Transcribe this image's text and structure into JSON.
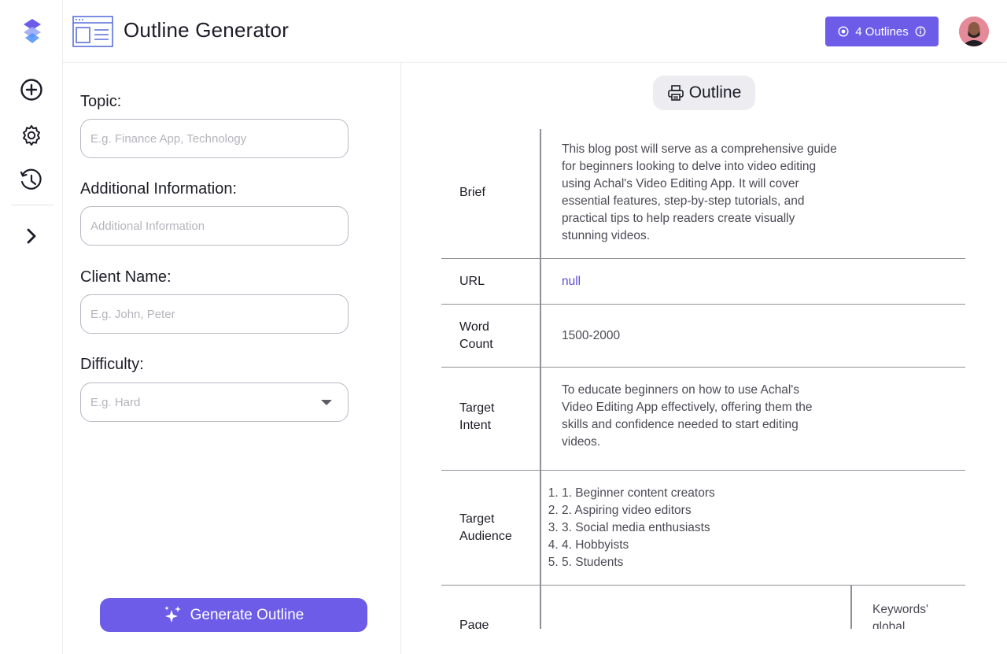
{
  "header": {
    "title": "Outline Generator",
    "badge_label": "4 Outlines"
  },
  "rail": {
    "icons": [
      "logo-icon",
      "add-icon",
      "settings-icon",
      "history-icon",
      "chevron-right-icon"
    ]
  },
  "form": {
    "topic_label": "Topic:",
    "topic_placeholder": "E.g. Finance App, Technology",
    "additional_label": "Additional Information:",
    "additional_placeholder": "Additional Information",
    "client_label": "Client Name:",
    "client_placeholder": "E.g. John, Peter",
    "difficulty_label": "Difficulty:",
    "difficulty_placeholder": "E.g. Hard",
    "generate_label": "Generate Outline"
  },
  "outline": {
    "chip_label": "Outline",
    "rows": [
      {
        "key": "Brief",
        "value": "This blog post will serve as a comprehensive guide for beginners looking to delve into video editing using Achal's Video Editing App. It will cover essential features, step-by-step tutorials, and practical tips to help readers create visually stunning videos."
      },
      {
        "key": "URL",
        "value": "null"
      },
      {
        "key": "Word Count",
        "value": "1500-2000"
      },
      {
        "key": "Target Intent",
        "value": "To educate beginners on how to use Achal's Video Editing App effectively, offering them the skills and confidence needed to start editing videos."
      },
      {
        "key": "Target Audience",
        "items": [
          "1. Beginner content creators",
          "2. Aspiring video editors",
          "3. Social media enthusiasts",
          "4. Hobbyists",
          "5. Students"
        ]
      },
      {
        "key": "Page",
        "sub_label": "Keywords' global"
      }
    ]
  },
  "colors": {
    "accent": "#6c5ce7",
    "link": "#5b4fd8",
    "border": "#8f8f98"
  }
}
